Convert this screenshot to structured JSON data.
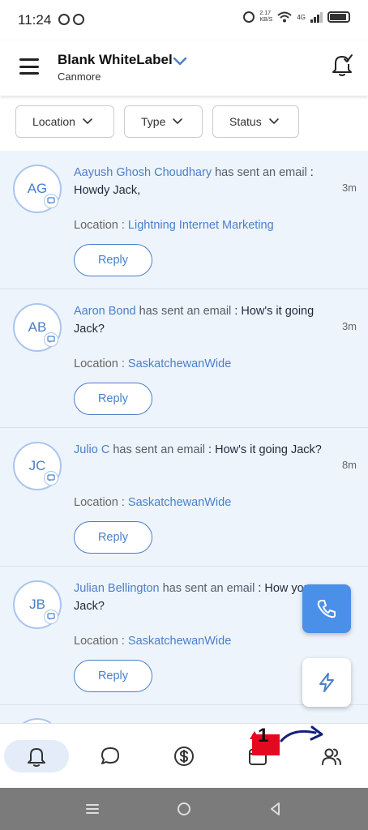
{
  "status_bar": {
    "time": "11:24",
    "net_speed_value": "2.17",
    "net_speed_unit": "KB/S",
    "network_type": "4G"
  },
  "header": {
    "account_name": "Blank WhiteLabel",
    "location_name": "Canmore"
  },
  "filters": [
    {
      "label": "Location"
    },
    {
      "label": "Type"
    },
    {
      "label": "Status"
    }
  ],
  "notifications": [
    {
      "initials": "AG",
      "name": "Aayush Ghosh Choudhary",
      "action": " has sent an email",
      "sep": " : ",
      "message": "Howdy Jack,",
      "time": "3m",
      "location_label": "Location : ",
      "location": "Lightning Internet Marketing",
      "reply_label": "Reply"
    },
    {
      "initials": "AB",
      "name": "Aaron Bond",
      "action": " has sent an email",
      "sep": " : ",
      "message": "How's it going Jack?",
      "time": "3m",
      "location_label": "Location : ",
      "location": "SaskatchewanWide",
      "reply_label": "Reply"
    },
    {
      "initials": "JC",
      "name": "Julio C",
      "action": " has sent an email",
      "sep": " : ",
      "message": "How's it going Jack?",
      "time": "8m",
      "location_label": "Location : ",
      "location": "SaskatchewanWide",
      "reply_label": "Reply"
    },
    {
      "initials": "JB",
      "name": "Julian Bellington",
      "action": " has sent an email",
      "sep": " : ",
      "message": "How you Jack?",
      "time": "",
      "location_label": "Location : ",
      "location": "SaskatchewanWide",
      "reply_label": "Reply"
    }
  ],
  "bottom_nav": [
    {
      "icon": "bell-icon",
      "active": true
    },
    {
      "icon": "chat-icon",
      "active": false
    },
    {
      "icon": "dollar-icon",
      "active": false
    },
    {
      "icon": "calendar-icon",
      "active": false
    },
    {
      "icon": "contacts-icon",
      "active": false
    }
  ],
  "annotation": {
    "badge": "1"
  },
  "colors": {
    "accent": "#4a7fc9",
    "list_bg": "#eef4fc",
    "fab_phone": "#4a8fe8",
    "annotation_red": "#e5091f"
  }
}
